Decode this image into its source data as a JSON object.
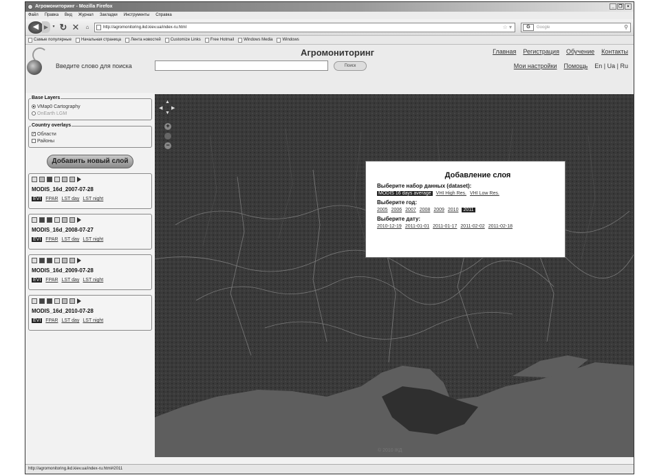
{
  "window": {
    "title": "Агромониторинг - Mozilla Firefox",
    "controls": [
      "_",
      "❐",
      "×"
    ]
  },
  "menubar": [
    "Файл",
    "Правка",
    "Вид",
    "Журнал",
    "Закладки",
    "Инструменты",
    "Справка"
  ],
  "nav": {
    "url": "http://agromonitoring.ikd.kiev.ua/index-ru.html",
    "search_placeholder": "Google",
    "search_engine": "G"
  },
  "bookmarks": [
    "Самые популярные",
    "Начальная страница",
    "Лента новостей",
    "Customize Links",
    "Free Hotmail",
    "Windows Media",
    "Windows"
  ],
  "header": {
    "site_title": "Агромониторинг",
    "search_label": "Введите слово для поиска",
    "search_button": "Поиск",
    "links_top": [
      "Главная",
      "Регистрация",
      "Обучение",
      "Контакты"
    ],
    "links_bottom": [
      "Мои настройки",
      "Помощь"
    ],
    "languages": "En | Ua | Ru"
  },
  "sidebar": {
    "base_layers": {
      "legend": "Base Layers",
      "options": [
        {
          "label": "VMap0 Cartography",
          "selected": true
        },
        {
          "label": "OnEarth LGM",
          "selected": false
        }
      ]
    },
    "country_overlays": {
      "legend": "Country overlays",
      "options": [
        {
          "label": "Области",
          "checked": true
        },
        {
          "label": "Районы",
          "checked": false
        }
      ]
    },
    "add_layer_button": "Добавить новый слой",
    "layers": [
      {
        "name": "MODIS_16d_2007-07-28",
        "links": [
          "EVI",
          "FPAR",
          "LST day",
          "LST night"
        ]
      },
      {
        "name": "MODIS_16d_2008-07-27",
        "links": [
          "EVI",
          "FPAR",
          "LST day",
          "LST night"
        ]
      },
      {
        "name": "MODIS_16d_2009-07-28",
        "links": [
          "EVI",
          "FPAR",
          "LST day",
          "LST night"
        ]
      },
      {
        "name": "MODIS_16d_2010-07-28",
        "links": [
          "EVI",
          "FPAR",
          "LST day",
          "LST night"
        ]
      }
    ]
  },
  "modal": {
    "title": "Добавление слоя",
    "dataset_label": "Выберите набор данных (dataset):",
    "datasets": [
      "MODIS 16 days average",
      "VHI High Res.",
      "VHI Low Res."
    ],
    "year_label": "Выберите год:",
    "years": [
      "2005",
      "2006",
      "2007",
      "2008",
      "2009",
      "2010",
      "2011"
    ],
    "selected_year": "2011",
    "date_label": "Выберите дату:",
    "dates": [
      "2010-12-19",
      "2011-01-01",
      "2011-01-17",
      "2011-02-02",
      "2011-02-18"
    ]
  },
  "map": {
    "copyright": "© 2010 ІКД"
  },
  "status": "http://agromonitoring.ikd.kiev.ua/index-ru.html#2011"
}
